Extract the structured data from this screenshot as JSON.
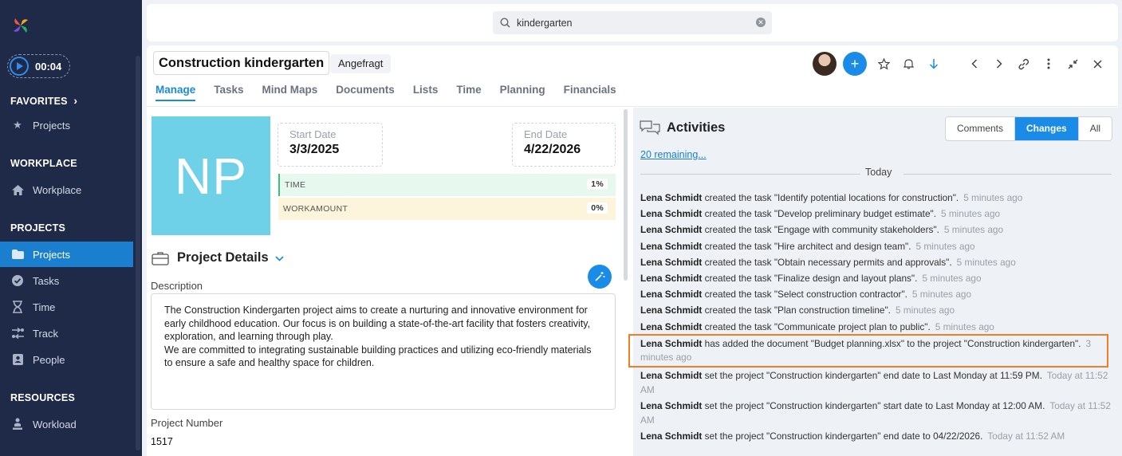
{
  "sidebar": {
    "timer": "00:04",
    "favorites": {
      "title": "FAVORITES",
      "items": [
        {
          "label": "Projects",
          "icon": "star-icon"
        }
      ]
    },
    "workplace": {
      "title": "WORKPLACE",
      "items": [
        {
          "label": "Workplace",
          "icon": "home-icon"
        }
      ]
    },
    "projects": {
      "title": "PROJECTS",
      "items": [
        {
          "label": "Projects",
          "icon": "folder-icon",
          "active": true
        },
        {
          "label": "Tasks",
          "icon": "check-circle-icon"
        },
        {
          "label": "Time",
          "icon": "hourglass-icon"
        },
        {
          "label": "Track",
          "icon": "track-icon"
        },
        {
          "label": "People",
          "icon": "contact-card-icon"
        }
      ]
    },
    "resources": {
      "title": "RESOURCES",
      "items": [
        {
          "label": "Workload",
          "icon": "person-workload-icon"
        }
      ]
    }
  },
  "search": {
    "value": "kindergarten"
  },
  "project": {
    "title": "Construction kindergarten",
    "status": "Angefragt",
    "tabs": [
      "Manage",
      "Tasks",
      "Mind Maps",
      "Documents",
      "Lists",
      "Time",
      "Planning",
      "Financials"
    ],
    "active_tab": "Manage",
    "initials": "NP",
    "start_date": {
      "label": "Start Date",
      "value": "3/3/2025"
    },
    "end_date": {
      "label": "End Date",
      "value": "4/22/2026"
    },
    "time": {
      "label": "TIME",
      "value": "1%"
    },
    "workamount": {
      "label": "WORKAMOUNT",
      "value": "0%"
    },
    "details_title": "Project Details",
    "description_label": "Description",
    "description": "The Construction Kindergarten project aims to create a nurturing and innovative environment for early childhood education. Our focus is on building a state-of-the-art facility that fosters creativity, exploration, and learning through play.\nWe are committed to integrating sustainable building practices and utilizing eco-friendly materials to ensure a safe and healthy space for children.",
    "project_number_label": "Project Number",
    "project_number": "1517"
  },
  "activities": {
    "title": "Activities",
    "filters": [
      "Comments",
      "Changes",
      "All"
    ],
    "active_filter": "Changes",
    "remaining": "20 remaining...",
    "day_label": "Today",
    "items": [
      {
        "user": "Lena Schmidt",
        "text": "created the task \"Identify potential locations for construction\".",
        "time": "5 minutes ago"
      },
      {
        "user": "Lena Schmidt",
        "text": "created the task \"Develop preliminary budget estimate\".",
        "time": "5 minutes ago"
      },
      {
        "user": "Lena Schmidt",
        "text": "created the task \"Engage with community stakeholders\".",
        "time": "5 minutes ago"
      },
      {
        "user": "Lena Schmidt",
        "text": "created the task \"Hire architect and design team\".",
        "time": "5 minutes ago"
      },
      {
        "user": "Lena Schmidt",
        "text": "created the task \"Obtain necessary permits and approvals\".",
        "time": "5 minutes ago"
      },
      {
        "user": "Lena Schmidt",
        "text": "created the task \"Finalize design and layout plans\".",
        "time": "5 minutes ago"
      },
      {
        "user": "Lena Schmidt",
        "text": "created the task \"Select construction contractor\".",
        "time": "5 minutes ago"
      },
      {
        "user": "Lena Schmidt",
        "text": "created the task \"Plan construction timeline\".",
        "time": "5 minutes ago"
      },
      {
        "user": "Lena Schmidt",
        "text": "created the task \"Communicate project plan to public\".",
        "time": "5 minutes ago"
      },
      {
        "user": "Lena Schmidt",
        "text": "has added the document \"Budget planning.xlsx\" to the project \"Construction kindergarten\".",
        "time": "3 minutes ago",
        "highlight": true
      },
      {
        "user": "Lena Schmidt",
        "text": "set the project \"Construction kindergarten\" end date to Last Monday at 11:59 PM.",
        "time": "Today at 11:52 AM"
      },
      {
        "user": "Lena Schmidt",
        "text": "set the project \"Construction kindergarten\" start date to Last Monday at 12:00 AM.",
        "time": "Today at 11:52 AM"
      },
      {
        "user": "Lena Schmidt",
        "text": "set the project \"Construction kindergarten\" end date to 04/22/2026.",
        "time": "Today at 11:52 AM"
      }
    ]
  },
  "colors": {
    "sidebar_bg": "#1e2a47",
    "accent": "#1a8be6",
    "highlight_outline": "#ef7e2b",
    "np_tile": "#6fd1e8"
  }
}
